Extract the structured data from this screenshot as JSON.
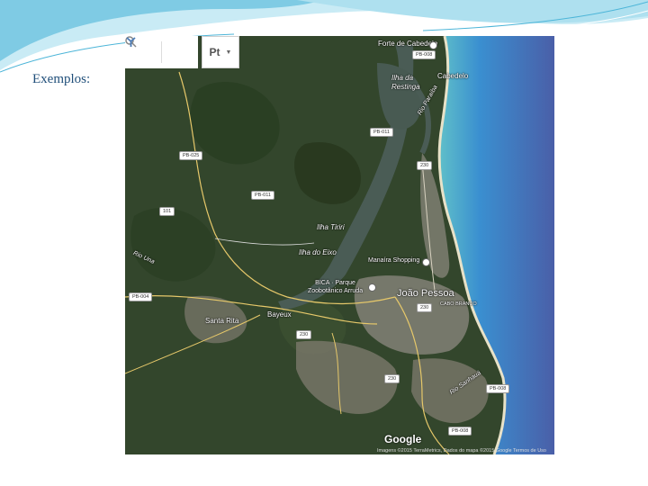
{
  "slide": {
    "title": "Exemplos:",
    "colors": {
      "title": "#1f4e79",
      "wave_light": "#9ed8ea",
      "wave_dark": "#4cb5d8"
    }
  },
  "map": {
    "toolbar": {
      "search_icon": "search-icon",
      "directions_icon": "directions-icon",
      "language_label": "Pt",
      "dropdown_icon": "caret-down-icon"
    },
    "places": {
      "forte": "Forte de Cabedelo",
      "cabedelo": "Cabedelo",
      "restinga": "Ilha da\nRestinga",
      "rio": "Rio Paraíba",
      "tiriri": "Ilha Tiriri",
      "eixo": "Ilha do Eixo",
      "shopping": "Manaíra Shopping",
      "bica": "BICA · Parque\nZoobotânico Arruda",
      "joao_pessoa": "João Pessoa",
      "cabo_branco": "CABO BRANCO",
      "santa_rita": "Santa Rita",
      "bayeux": "Bayeux",
      "rio_una": "Rio Una",
      "rio_sanhaua": "Rio Sanhauá"
    },
    "roads": {
      "pb008_top": "PB-008",
      "pb011_a": "PB-011",
      "pb025": "PB-025",
      "pb011_b": "PB-011",
      "r230_a": "230",
      "r101": "101",
      "pb004": "PB-004",
      "r230_b": "230",
      "r230_c": "230",
      "r230_d": "230",
      "pb008_mid": "PB-008",
      "pb008_bottom": "PB-008"
    },
    "google": "Google",
    "attribution": "Imagens ©2015 TerraMetrics, Dados do mapa ©2015 Google    Termos de Uso",
    "colors": {
      "land": "#33462c",
      "ocean": "#3a7fc4",
      "deep_ocean": "#4a5fa8",
      "urban": "#8e8a80",
      "water": "#4a5c55"
    }
  }
}
